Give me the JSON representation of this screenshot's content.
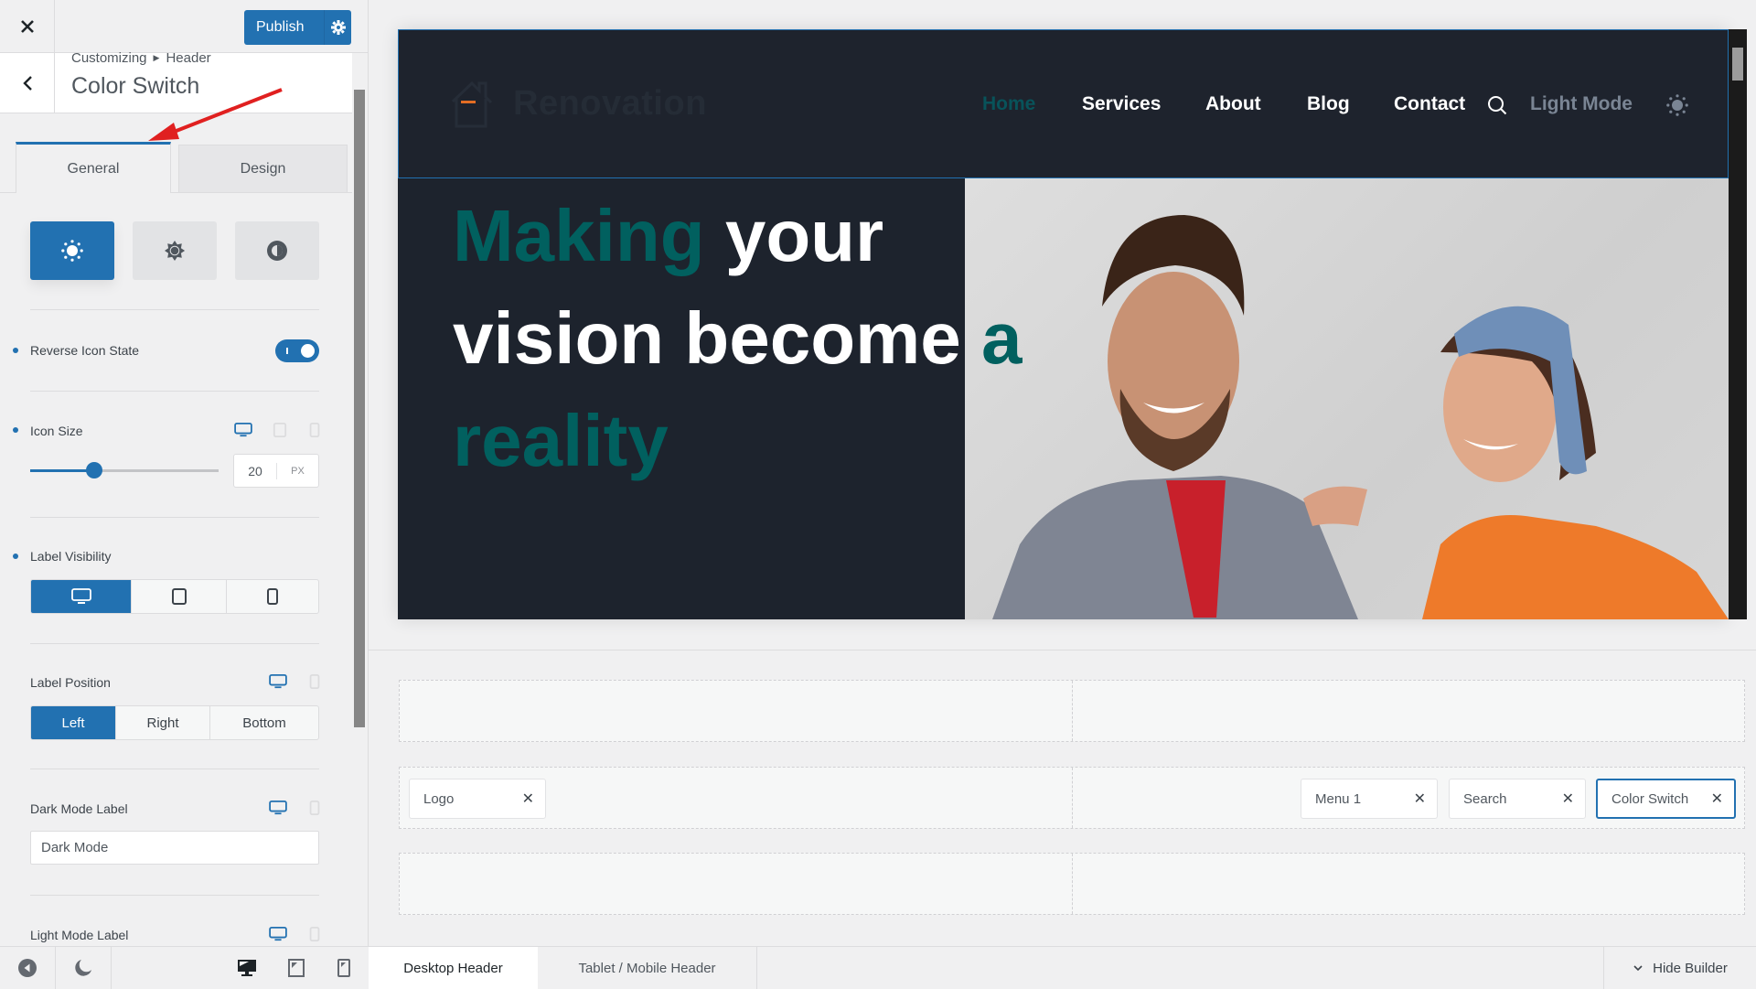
{
  "customizer": {
    "close_label": "×",
    "publish_label": "Publish",
    "breadcrumb": [
      "Customizing",
      "Header"
    ],
    "section_title": "Color Switch",
    "tabs": [
      {
        "label": "General",
        "active": true
      },
      {
        "label": "Design",
        "active": false
      }
    ],
    "icon_styles": [
      {
        "name": "sun-dots",
        "active": true
      },
      {
        "name": "sun-star",
        "active": false
      },
      {
        "name": "contrast",
        "active": false
      }
    ],
    "reverse_icon_state": {
      "label": "Reverse Icon State",
      "value": true
    },
    "icon_size": {
      "label": "Icon Size",
      "value": "20",
      "unit": "PX",
      "slider_fraction": 0.34
    },
    "label_visibility": {
      "label": "Label Visibility",
      "options": [
        "desktop",
        "tablet",
        "mobile"
      ],
      "active": "desktop"
    },
    "label_position": {
      "label": "Label Position",
      "options": [
        "Left",
        "Right",
        "Bottom"
      ],
      "active": "Left"
    },
    "dark_mode_label": {
      "label": "Dark Mode Label",
      "value": "Dark Mode"
    },
    "light_mode_label": {
      "label": "Light Mode Label"
    }
  },
  "preview": {
    "logo_text": "Renovation",
    "nav": [
      "Home",
      "Services",
      "About",
      "Blog",
      "Contact"
    ],
    "mode_label": "Light Mode",
    "headline": {
      "part1": "Making",
      "part2": " your vision become ",
      "part3": "a",
      "part4": "reality"
    },
    "colors": {
      "accent_teal": "#01605f",
      "header_bg": "#1e232d",
      "wp_blue": "#2271b1"
    }
  },
  "builder": {
    "rows": [
      {
        "left": [],
        "right": []
      },
      {
        "left": [
          {
            "label": "Logo"
          }
        ],
        "right": [
          {
            "label": "Menu 1"
          },
          {
            "label": "Search"
          },
          {
            "label": "Color Switch",
            "selected": true
          }
        ]
      },
      {
        "left": [],
        "right": []
      }
    ],
    "bottom_tabs": [
      {
        "label": "Desktop Header",
        "active": true
      },
      {
        "label": "Tablet / Mobile Header",
        "active": false
      }
    ],
    "hide_builder_label": "Hide Builder"
  }
}
